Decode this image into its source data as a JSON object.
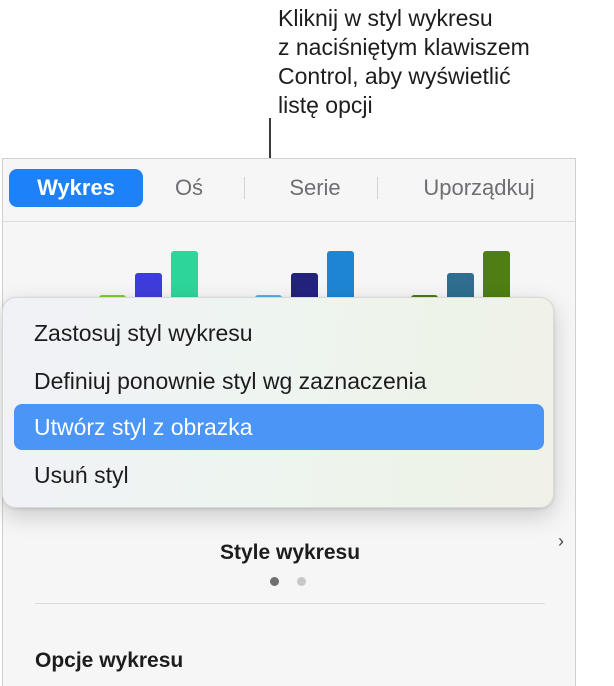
{
  "callout": {
    "text": "Kliknij w styl wykresu\nz naciśniętym klawiszem\nControl, aby wyświetlić\nlistę opcji"
  },
  "tabs": [
    {
      "label": "Wykres",
      "active": true
    },
    {
      "label": "Oś",
      "active": false
    },
    {
      "label": "Serie",
      "active": false
    },
    {
      "label": "Uporządkuj",
      "active": false
    }
  ],
  "context_menu": {
    "items": [
      {
        "label": "Zastosuj styl wykresu",
        "highlighted": false
      },
      {
        "label": "Definiuj ponownie styl wg zaznaczenia",
        "highlighted": false
      },
      {
        "label": "Utwórz styl z obrazka",
        "highlighted": true
      },
      {
        "label": "Usuń styl",
        "highlighted": false
      }
    ]
  },
  "chart_styles": {
    "title": "Style wykresu",
    "page_count": 2,
    "current_page": 1,
    "thumbnails": [
      {
        "colors": [
          "#7ed321",
          "#3d3ddb",
          "#2ed59a"
        ]
      },
      {
        "colors": [
          "#52b4f2",
          "#23237e",
          "#1d86d4"
        ]
      },
      {
        "colors": [
          "#4f7a13",
          "#2f6e8f",
          "#4f7e14"
        ]
      }
    ]
  },
  "chart_options": {
    "title": "Opcje wykresu"
  },
  "colors": {
    "accent": "#1d82f7",
    "menu_highlight": "#4a95f5"
  }
}
